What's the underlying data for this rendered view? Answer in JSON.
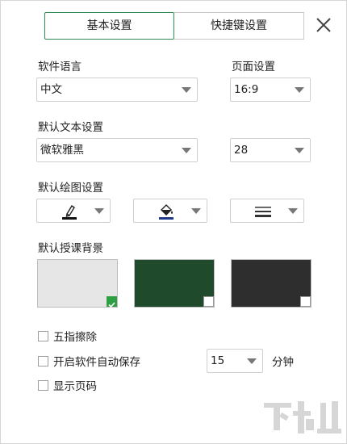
{
  "tabs": {
    "basic": "基本设置",
    "shortcut": "快捷键设置"
  },
  "language": {
    "label": "软件语言",
    "value": "中文"
  },
  "page": {
    "label": "页面设置",
    "value": "16:9"
  },
  "text": {
    "label": "默认文本设置",
    "font": "微软雅黑",
    "size": "28"
  },
  "drawing": {
    "label": "默认绘图设置",
    "icons": [
      "pen-icon",
      "fill-bucket-icon",
      "line-style-icon"
    ]
  },
  "background": {
    "label": "默认授课背景",
    "options": [
      {
        "name": "white-board",
        "color": "#e6e6e6",
        "selected": true
      },
      {
        "name": "green-board",
        "color": "#1f4a2b",
        "selected": false
      },
      {
        "name": "black-board",
        "color": "#2e2e2e",
        "selected": false
      }
    ]
  },
  "options": {
    "five_finger_erase": "五指擦除",
    "auto_save": "开启软件自动保存",
    "auto_save_minutes": "15",
    "minutes_unit": "分钟",
    "show_page_number": "显示页码"
  }
}
